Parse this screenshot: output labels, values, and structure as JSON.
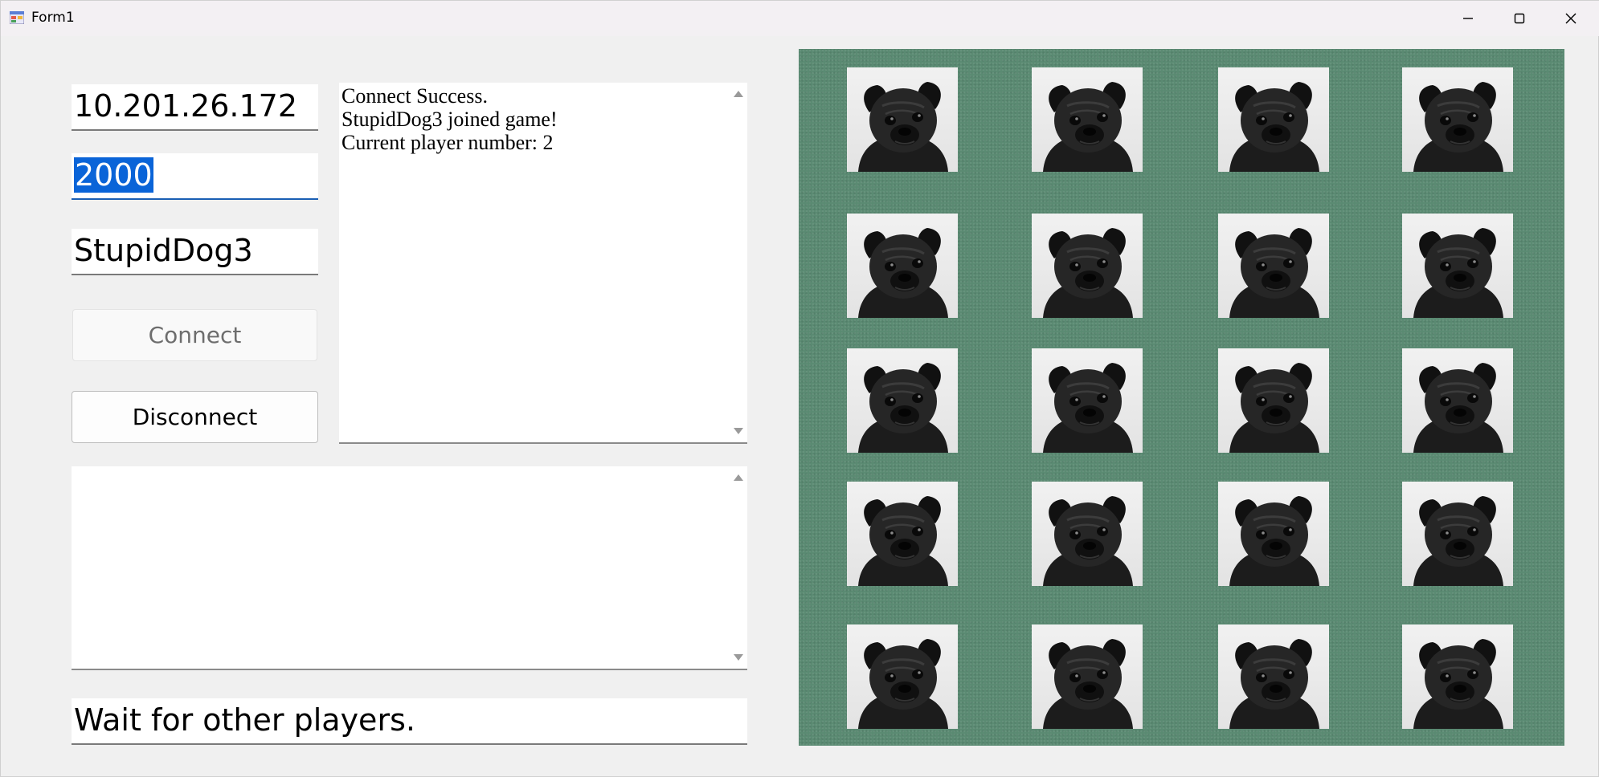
{
  "window": {
    "title": "Form1",
    "icons": {
      "app": "form-app-icon",
      "minimize": "minimize-icon",
      "maximize": "maximize-icon",
      "close": "close-icon"
    }
  },
  "connection": {
    "ip": "10.201.26.172",
    "port": "2000",
    "player_name": "StupidDog3",
    "connect_label": "Connect",
    "disconnect_label": "Disconnect"
  },
  "log": {
    "lines": [
      "Connect Success.",
      "StupidDog3 joined game!",
      "Current player number: 2"
    ]
  },
  "chat": {
    "text": ""
  },
  "status": {
    "text": "Wait for other players."
  },
  "board": {
    "background_color": "#5a8a72",
    "rows": 5,
    "cols": 4,
    "card_icon": "pug-dog-icon"
  }
}
